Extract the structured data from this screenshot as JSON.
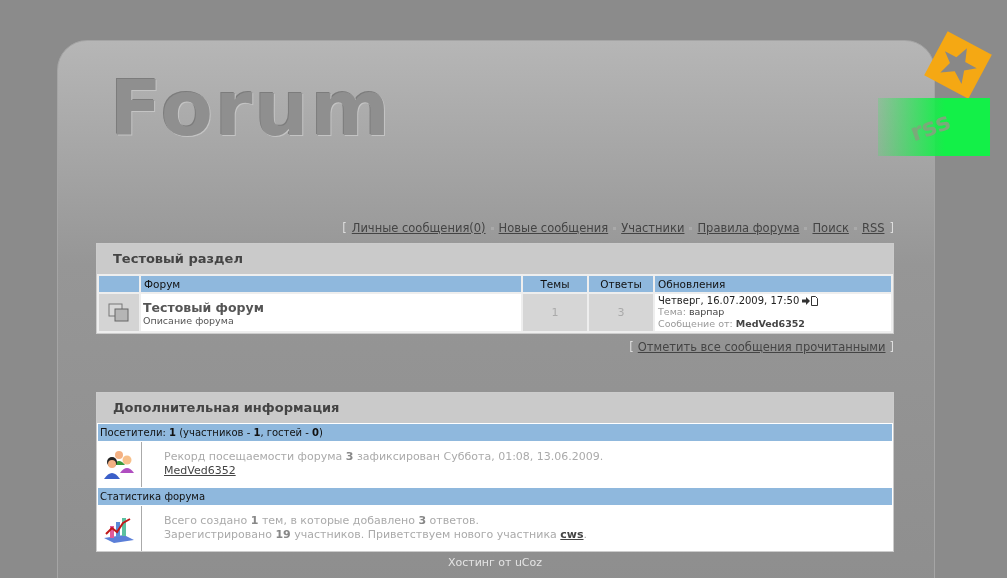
{
  "header": {
    "title": "Forum",
    "rss_logo": "rss"
  },
  "nav": {
    "open": "[",
    "close": "]",
    "links": [
      "Личные сообщения(0)",
      "Новые сообщения",
      "Участники",
      "Правила форума",
      "Поиск",
      "RSS"
    ]
  },
  "sections": [
    {
      "title": "Тестовый раздел",
      "columns": [
        "Форум",
        "Темы",
        "Ответы",
        "Обновления"
      ],
      "forums": [
        {
          "name": "Тестовый форум",
          "description": "Описание форума",
          "topics": "1",
          "replies": "3",
          "last_post": {
            "date": "Четверг, 16.07.2009, 17:50",
            "topic_label": "Тема:",
            "topic": "варпар",
            "author_label": "Сообщение от:",
            "author": "MedVed6352"
          }
        }
      ]
    }
  ],
  "mark_read": {
    "open": "[",
    "link": "Отметить все сообщения прочитанными",
    "close": "]"
  },
  "info": {
    "title": "Дополнительная информация",
    "blocks": [
      {
        "kind": "visitors",
        "heading": "Посетители: **1**  (участников - **1**, гостей - **0**)",
        "lines": [
          {
            "text": "Рекорд посещаемости форума **3** зафиксирован Суббота, 01:08, 13.06.2009."
          },
          {
            "link": "MedVed6352"
          }
        ]
      },
      {
        "kind": "stats",
        "heading": "Статистика форума",
        "lines": [
          {
            "text": "Всего создано **1** тем, в которые добавлено **3** ответов."
          },
          {
            "text": "Зарегистрировано **19** участников. Приветствуем нового участника ",
            "link": "cws",
            "tail": "."
          }
        ]
      }
    ]
  },
  "footer": "Хостинг от uCoz"
}
